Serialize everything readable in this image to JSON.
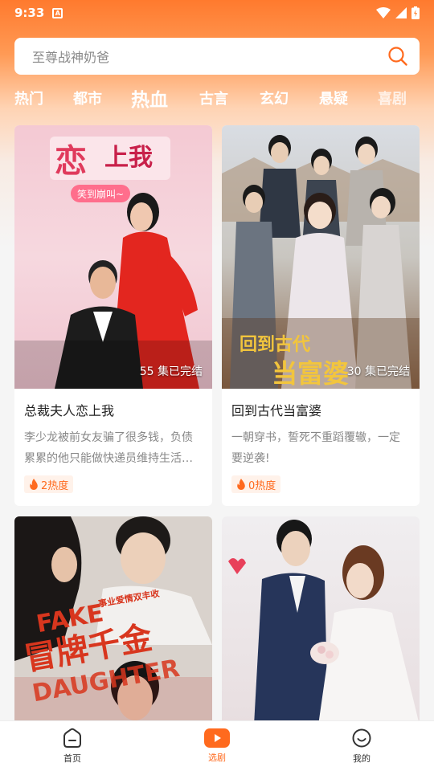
{
  "status_bar": {
    "time": "9:33"
  },
  "search": {
    "placeholder": "至尊战神奶爸"
  },
  "tabs": [
    {
      "label": "热门"
    },
    {
      "label": "都市"
    },
    {
      "label": "热血"
    },
    {
      "label": "古言"
    },
    {
      "label": "玄幻"
    },
    {
      "label": "悬疑"
    },
    {
      "label": "喜剧"
    }
  ],
  "active_tab": "热血",
  "cards": [
    {
      "title": "总裁夫人恋上我",
      "episodes": "55 集已完结",
      "description": "李少龙被前女友骗了很多钱，负债累累的他只能做快递员维持生活…",
      "heat": "2热度",
      "poster_text": [
        "恋",
        "上我",
        "笑到崩叫~"
      ]
    },
    {
      "title": "回到古代当富婆",
      "episodes": "30 集已完结",
      "description": "一朝穿书，誓死不重蹈覆辙，一定要逆袭!",
      "heat": "0热度",
      "poster_text": [
        "回到古代",
        "当富婆"
      ]
    },
    {
      "title": "",
      "episodes": "",
      "description": "",
      "heat": "",
      "poster_text": [
        "FAKE",
        "冒牌千金",
        "DAUGHTER",
        "事业爱情双丰收"
      ]
    },
    {
      "title": "",
      "episodes": "",
      "description": "",
      "heat": "",
      "poster_text": []
    }
  ],
  "bottom_nav": [
    {
      "label": "首页",
      "icon": "home-icon"
    },
    {
      "label": "选剧",
      "icon": "play-icon"
    },
    {
      "label": "我的",
      "icon": "profile-icon"
    }
  ],
  "active_nav": "选剧",
  "colors": {
    "accent": "#ff6a1e",
    "heat_bg": "#fff2ea"
  }
}
